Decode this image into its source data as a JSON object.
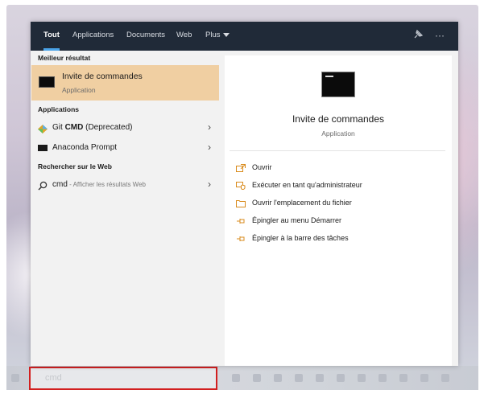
{
  "tabs": [
    {
      "label": "Tout"
    },
    {
      "label": "Applications"
    },
    {
      "label": "Documents"
    },
    {
      "label": "Web"
    },
    {
      "label": "Plus"
    }
  ],
  "top_icons": [
    {
      "icon": "feedback-pin-icon",
      "glyph": "⚲"
    },
    {
      "icon": "more-options-icon",
      "glyph": "···"
    }
  ],
  "left": {
    "best_match_heading": "Meilleur résultat",
    "best_match": {
      "title": "Invite de commandes",
      "subtitle": "Application"
    },
    "apps_heading": "Applications",
    "apps": [
      {
        "name_prefix": "Git ",
        "name_bold": "CMD",
        "name_suffix": " (Deprecated)",
        "icon": "git-icon"
      },
      {
        "name": "Anaconda Prompt",
        "icon": "terminal-icon"
      }
    ],
    "web_heading": "Rechercher sur le Web",
    "web_result": {
      "query": "cmd",
      "hint": " - Afficher les résultats Web"
    }
  },
  "right": {
    "title": "Invite de commandes",
    "subtitle": "Application",
    "actions": [
      {
        "label": "Ouvrir",
        "icon": "open-icon"
      },
      {
        "label": "Exécuter en tant qu'administrateur",
        "icon": "shield-admin-icon"
      },
      {
        "label": "Ouvrir l'emplacement du fichier",
        "icon": "folder-location-icon"
      },
      {
        "label": "Épingler au menu Démarrer",
        "icon": "pin-icon"
      },
      {
        "label": "Épingler à la barre des tâches",
        "icon": "pin-icon"
      }
    ]
  },
  "search": {
    "value": "cmd"
  },
  "colors": {
    "topbar": "#202a38",
    "highlight": "#f0cfa2",
    "accent": "#d98b1c",
    "search_outline": "#d21f1f"
  }
}
